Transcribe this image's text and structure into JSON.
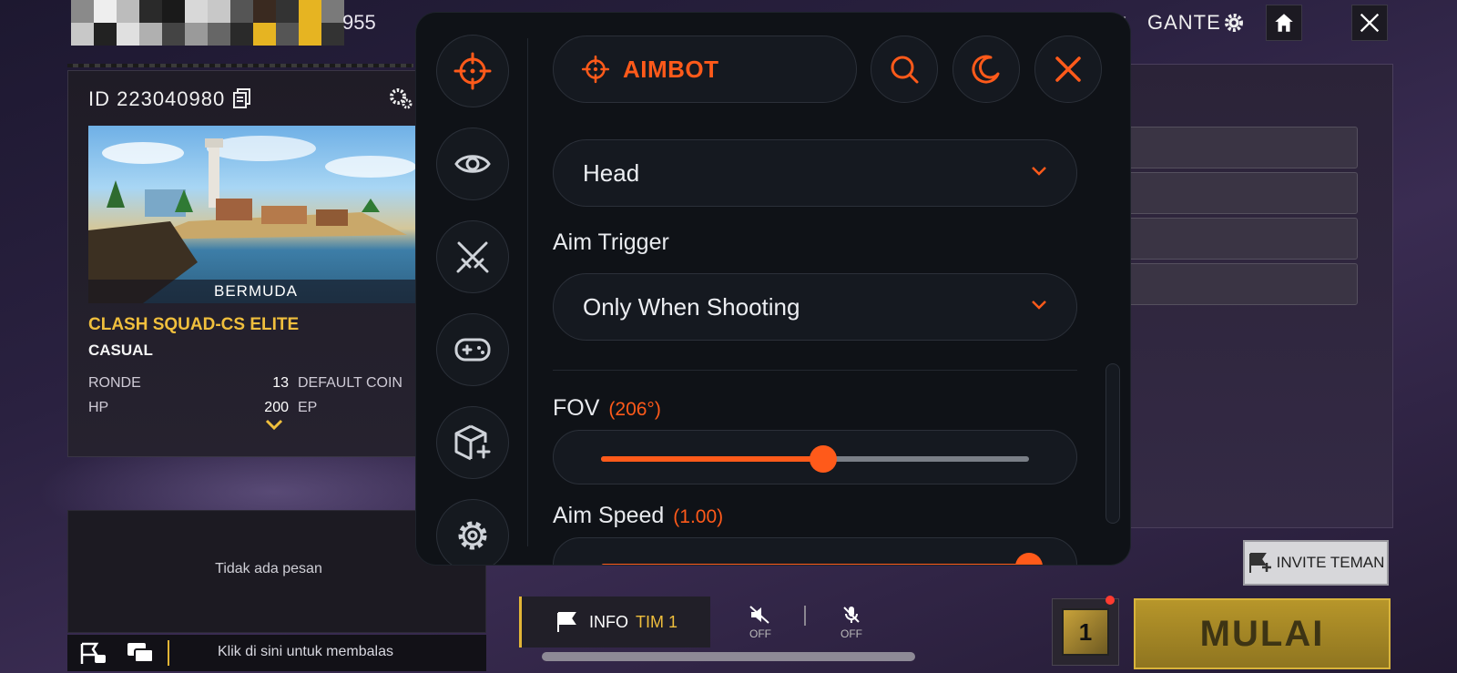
{
  "colors": {
    "accent": "#ff5a1a",
    "panel_bg": "#0f1217",
    "gold": "#f0bf3d"
  },
  "game": {
    "top_number": "955",
    "player_name_partial": "Y",
    "player_name": "GANTE",
    "room_id": "ID 223040980",
    "map_name": "BERMUDA",
    "mode_title": "CLASH SQUAD-CS ELITE",
    "mode_sub": "CASUAL",
    "stats": [
      {
        "label": "RONDE",
        "value": "13",
        "label2": "DEFAULT COIN"
      },
      {
        "label": "HP",
        "value": "200",
        "label2": "EP"
      }
    ],
    "chat_empty": "Tidak ada pesan",
    "chat_hint": "Klik di sini untuk membalas",
    "info_tim_prefix": "INFO",
    "info_tim_suffix": "TIM 1",
    "speaker_status": "OFF",
    "mic_status": "OFF",
    "invite_label": "INVITE TEMAN",
    "cube_label": "1",
    "start_label": "MULAI"
  },
  "panel": {
    "sidebar": [
      {
        "icon": "crosshair-icon",
        "active": true
      },
      {
        "icon": "eye-icon",
        "active": false
      },
      {
        "icon": "swords-icon",
        "active": false
      },
      {
        "icon": "gamepad-icon",
        "active": false
      },
      {
        "icon": "box-plus-icon",
        "active": false
      },
      {
        "icon": "gear-icon",
        "active": false
      }
    ],
    "header_title": "AIMBOT",
    "target_select": "Head",
    "aim_trigger_label": "Aim Trigger",
    "aim_trigger_value": "Only When Shooting",
    "fov_label": "FOV",
    "fov_value": "(206°)",
    "fov_fraction": 0.52,
    "aim_speed_label": "Aim Speed",
    "aim_speed_value": "(1.00)",
    "aim_speed_fraction": 1.0
  }
}
